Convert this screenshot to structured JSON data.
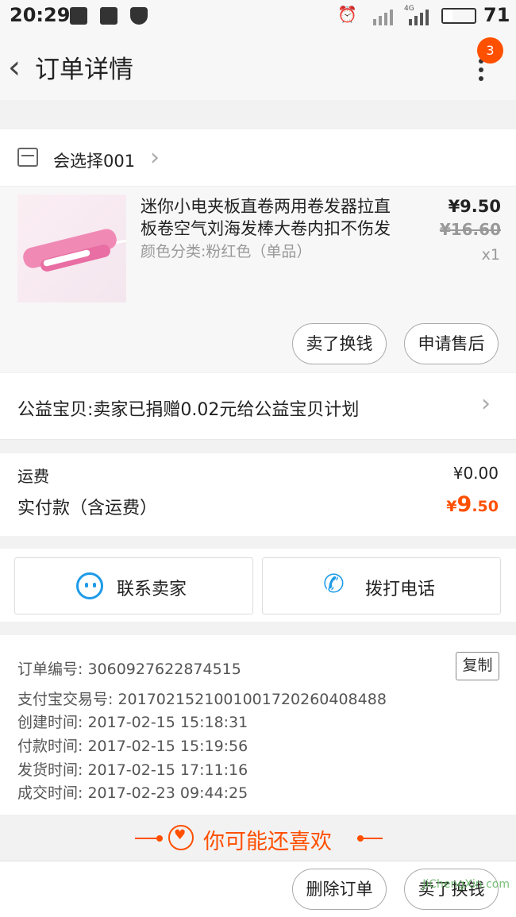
{
  "status": {
    "time": "20:29",
    "network": "4G",
    "battery": "71"
  },
  "header": {
    "title": "订单详情",
    "badge": "3"
  },
  "shop": {
    "name": "会选择001"
  },
  "product": {
    "title": "迷你小电夹板直卷两用卷发器拉直板卷空气刘海发棒大卷内扣不伤发",
    "spec": "颜色分类:粉红色（单品）",
    "price": "¥9.50",
    "original_price": "¥16.60",
    "quantity": "x1",
    "actions": [
      "卖了换钱",
      "申请售后"
    ]
  },
  "charity": {
    "text": "公益宝贝:卖家已捐赠0.02元给公益宝贝计划"
  },
  "fees": {
    "shipping_label": "运费",
    "shipping_value": "¥0.00",
    "paid_label": "实付款（含运费）",
    "paid_currency": "¥",
    "paid_integer": "9",
    "paid_decimal": ".50"
  },
  "contact": {
    "seller_label": "联系卖家",
    "phone_label": "拨打电话"
  },
  "order_info": {
    "order_no": "订单编号: 3060927622874515",
    "copy_label": "复制",
    "alipay_no": "支付宝交易号: 2017021521001001720260408488",
    "created": "创建时间: 2017-02-15 15:18:31",
    "paid": "付款时间: 2017-02-15 15:19:56",
    "shipped": "发货时间: 2017-02-15 17:11:16",
    "completed": "成交时间: 2017-02-23 09:44:25"
  },
  "recommend": {
    "text": "你可能还喜欢"
  },
  "bottom": {
    "delete_label": "删除订单",
    "sell_label": "卖了换钱"
  },
  "watermark": "JiChengXin.com",
  "colors": {
    "accent": "#ff5000",
    "contact_icon": "#1e9be8"
  }
}
